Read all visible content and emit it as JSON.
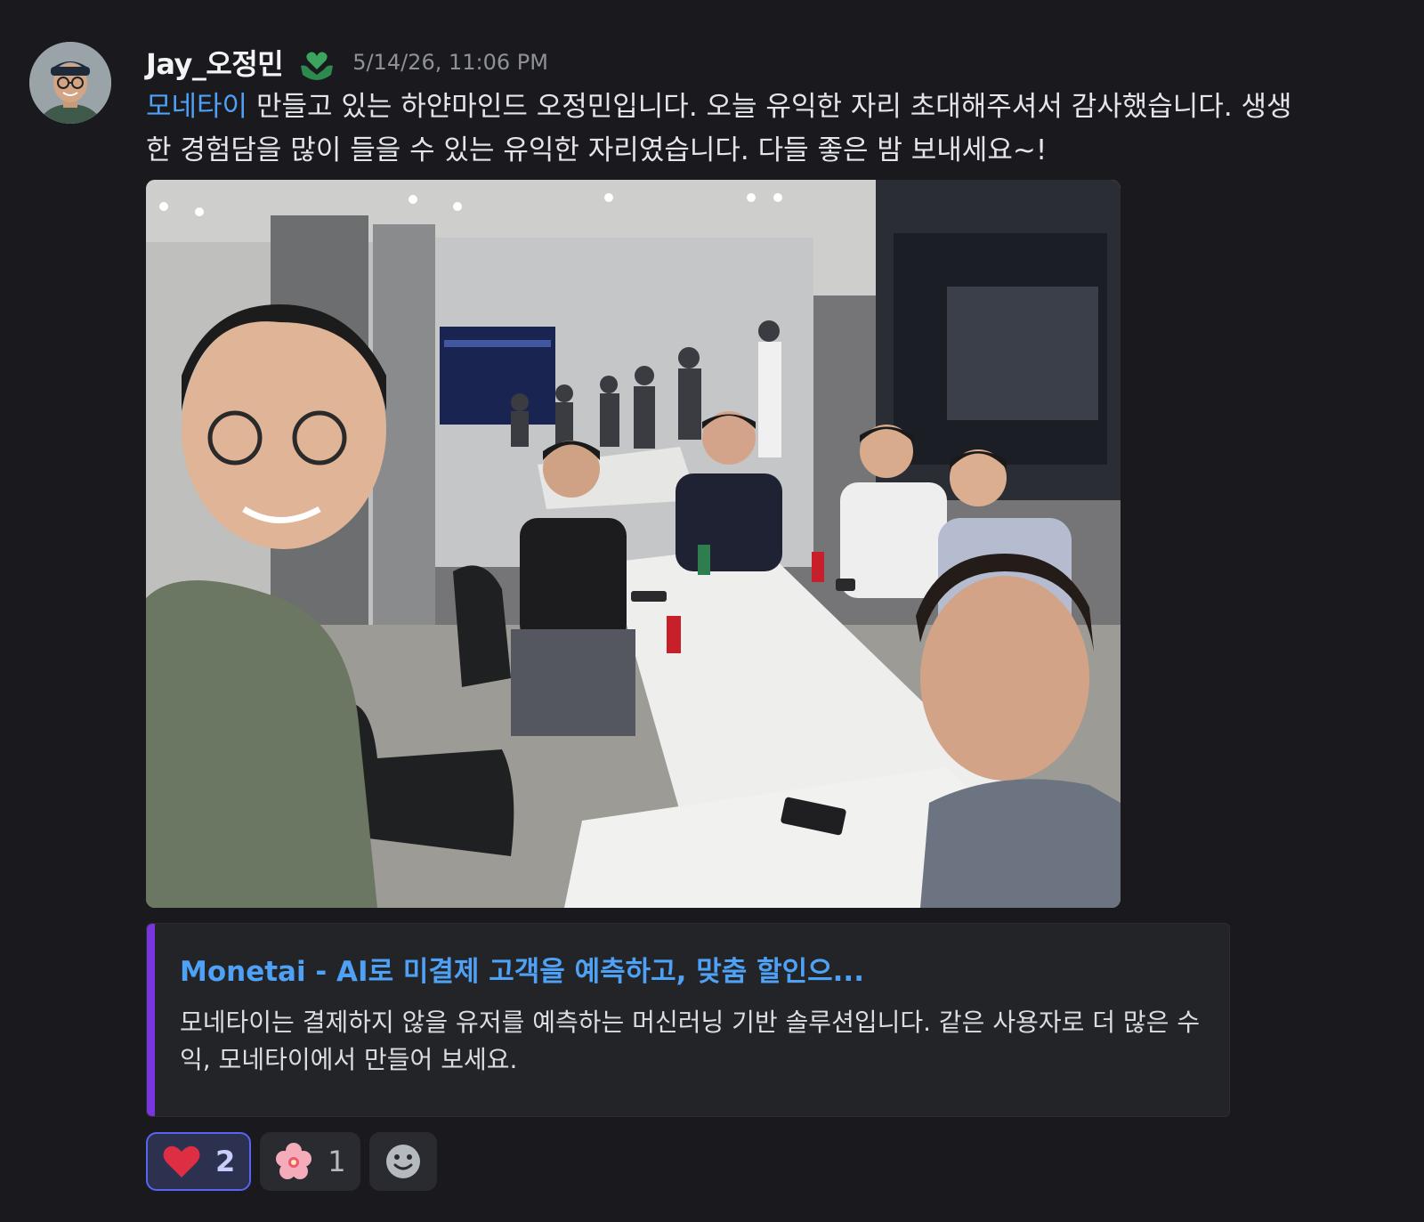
{
  "message": {
    "author": "Jay_오정민",
    "timestamp": "5/14/26, 11:06 PM",
    "link_text": "모네타이",
    "text": " 만들고 있는 하얀마인드 오정민입니다. 오늘 유익한 자리 초대해주셔서 감사했습니다. 생생한 경험담을 많이 들을 수 있는 유익한 자리였습니다. 다들 좋은 밤 보내세요~!"
  },
  "embed": {
    "title": "Monetai - AI로 미결제 고객을 예측하고, 맞춤 할인으...",
    "description": "모네타이는 결제하지 않을 유저를 예측하는 머신러닝 기반 솔루션입니다. 같은 사용자로 더 많은 수익, 모네타이에서 만들어 보세요."
  },
  "reactions": [
    {
      "emoji": "heart-icon",
      "count": "2",
      "active": true
    },
    {
      "emoji": "cherry-blossom-icon",
      "count": "1",
      "active": false
    }
  ],
  "colors": {
    "background": "#1a1a1e",
    "link": "#4ea1f5",
    "embed_accent": "#7a35e0",
    "reaction_active_border": "#5865f2"
  }
}
